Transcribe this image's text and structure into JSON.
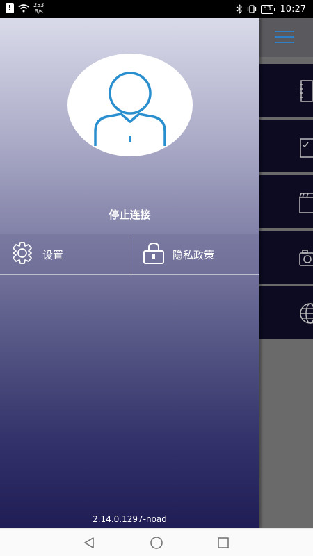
{
  "status_bar": {
    "net_speed_value": "253",
    "net_speed_unit": "B/s",
    "battery": "53",
    "time": "10:27"
  },
  "drawer": {
    "disconnect_label": "停止连接",
    "settings_label": "设置",
    "privacy_label": "隐私政策",
    "version": "2.14.0.1297-noad"
  },
  "icons": {
    "avatar": "user-icon",
    "settings": "gear-icon",
    "privacy": "lock-icon",
    "app_tiles": [
      "notebook-icon",
      "checklist-icon",
      "clapperboard-icon",
      "camera-icon",
      "globe-icon"
    ],
    "nav": [
      "back-icon",
      "home-icon",
      "recents-icon"
    ]
  },
  "colors": {
    "accent": "#2f7fc6",
    "drawer_top": "#d9dae9",
    "drawer_bottom": "#201d55",
    "tile_bg": "#0c0b22"
  }
}
